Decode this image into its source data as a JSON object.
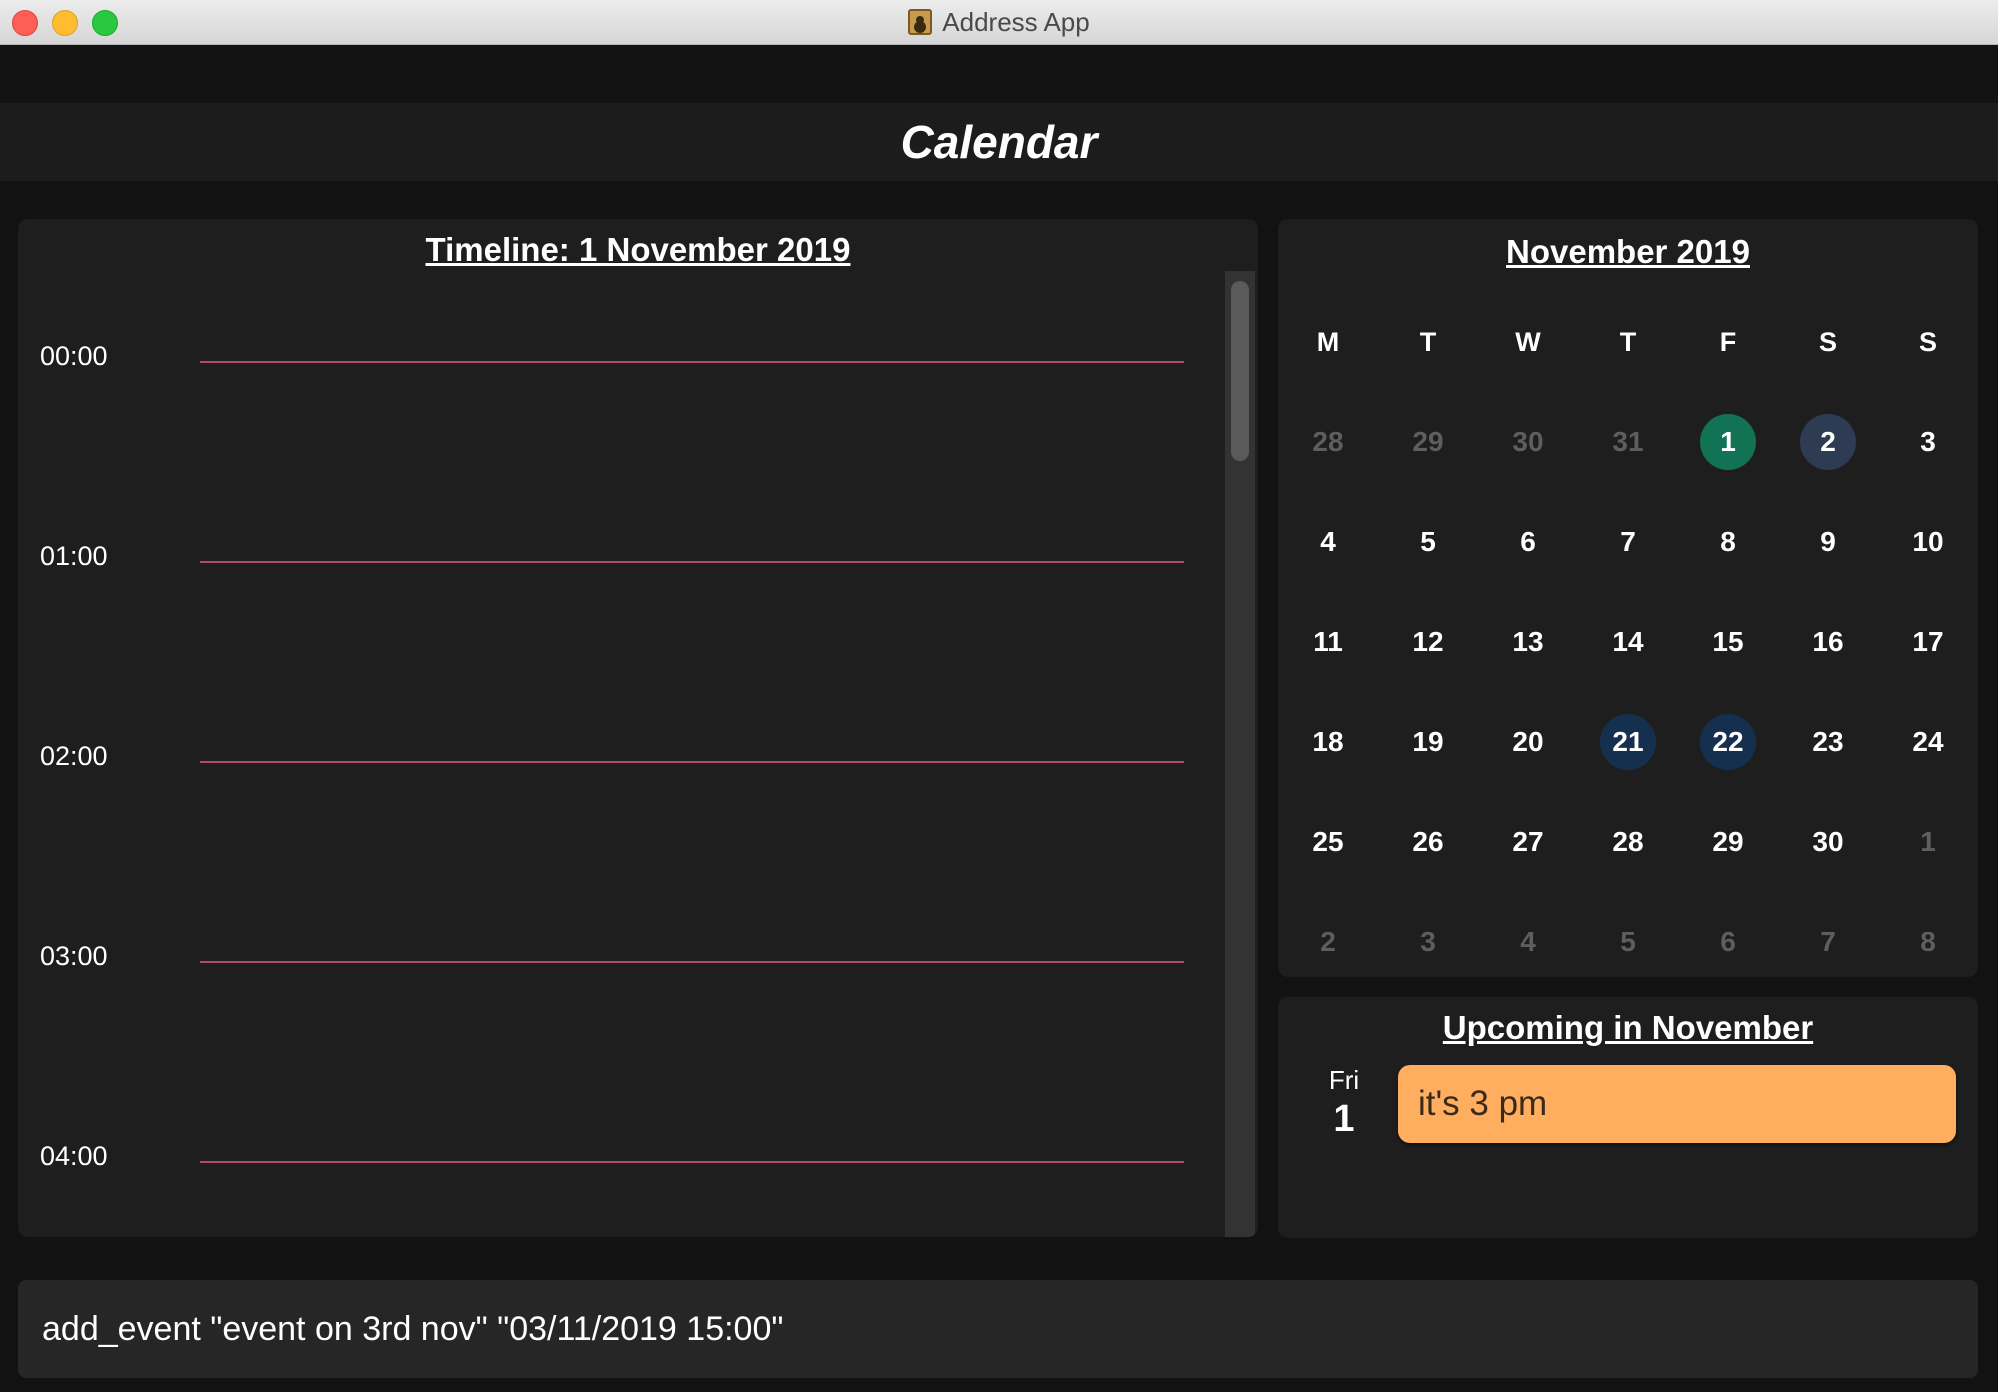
{
  "window": {
    "title": "Address App",
    "icon": "address-book-icon"
  },
  "header": {
    "title": "Calendar"
  },
  "timeline": {
    "title": "Timeline: 1 November 2019",
    "hours": [
      "00:00",
      "01:00",
      "02:00",
      "03:00",
      "04:00"
    ]
  },
  "calendar": {
    "title": "November 2019",
    "weekdays": [
      "M",
      "T",
      "W",
      "T",
      "F",
      "S",
      "S"
    ],
    "weeks": [
      [
        "28",
        "29",
        "30",
        "31",
        "1",
        "2",
        "3"
      ],
      [
        "4",
        "5",
        "6",
        "7",
        "8",
        "9",
        "10"
      ],
      [
        "11",
        "12",
        "13",
        "14",
        "15",
        "16",
        "17"
      ],
      [
        "18",
        "19",
        "20",
        "21",
        "22",
        "23",
        "24"
      ],
      [
        "25",
        "26",
        "27",
        "28",
        "29",
        "30",
        "1"
      ],
      [
        "2",
        "3",
        "4",
        "5",
        "6",
        "7",
        "8"
      ]
    ],
    "outside_month_cells": [
      "0-0",
      "0-1",
      "0-2",
      "0-3",
      "4-6",
      "5-0",
      "5-1",
      "5-2",
      "5-3",
      "5-4",
      "5-5",
      "5-6"
    ],
    "today_cell": "0-4",
    "selected_cell": "0-5",
    "event_cells": [
      "3-3",
      "3-4"
    ]
  },
  "upcoming": {
    "title": "Upcoming in November",
    "items": [
      {
        "weekday": "Fri",
        "date": "1",
        "event": "it's 3 pm"
      }
    ]
  },
  "command": {
    "text": "add_event \"event on 3rd nov\" \"03/11/2019 15:00\""
  },
  "colors": {
    "today": "#127354",
    "selected": "#2d3c52",
    "event_day": "#15304e",
    "timeline_line": "#b24a6a",
    "event_card": "#ffad5e"
  }
}
